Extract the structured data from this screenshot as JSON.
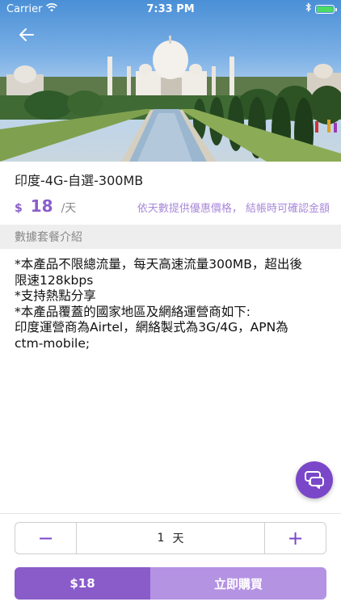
{
  "status": {
    "carrier": "Carrier",
    "time": "7:33 PM",
    "battery_level": 1.0
  },
  "product": {
    "title": "印度-4G-自選-300MB",
    "currency": "$",
    "price": "18",
    "unit": "/天",
    "promo": "依天數提供優惠價格， 結帳時可確認金額"
  },
  "section": {
    "header": "數據套餐介紹"
  },
  "description": {
    "lines": [
      "*本產品不限總流量，每天高速流量300MB，超出後",
      "限速128kbps",
      "*支持熱點分享",
      "*本產品覆蓋的國家地區及網絡運營商如下:",
      "印度運營商為Airtel，網絡製式為3G/4G，APN為",
      "ctm-mobile;"
    ]
  },
  "stepper": {
    "minus": "−",
    "value": "1",
    "unit": "天",
    "plus": "+"
  },
  "buy": {
    "total": "$18",
    "action": "立即購買"
  },
  "icons": {
    "back": "arrow-left-icon",
    "wifi": "wifi-icon",
    "battery": "battery-icon",
    "chat": "chat-bubble-icon"
  },
  "colors": {
    "accent": "#8a5cc9",
    "accent_light": "#b593e3",
    "fab": "#7a47c8"
  }
}
